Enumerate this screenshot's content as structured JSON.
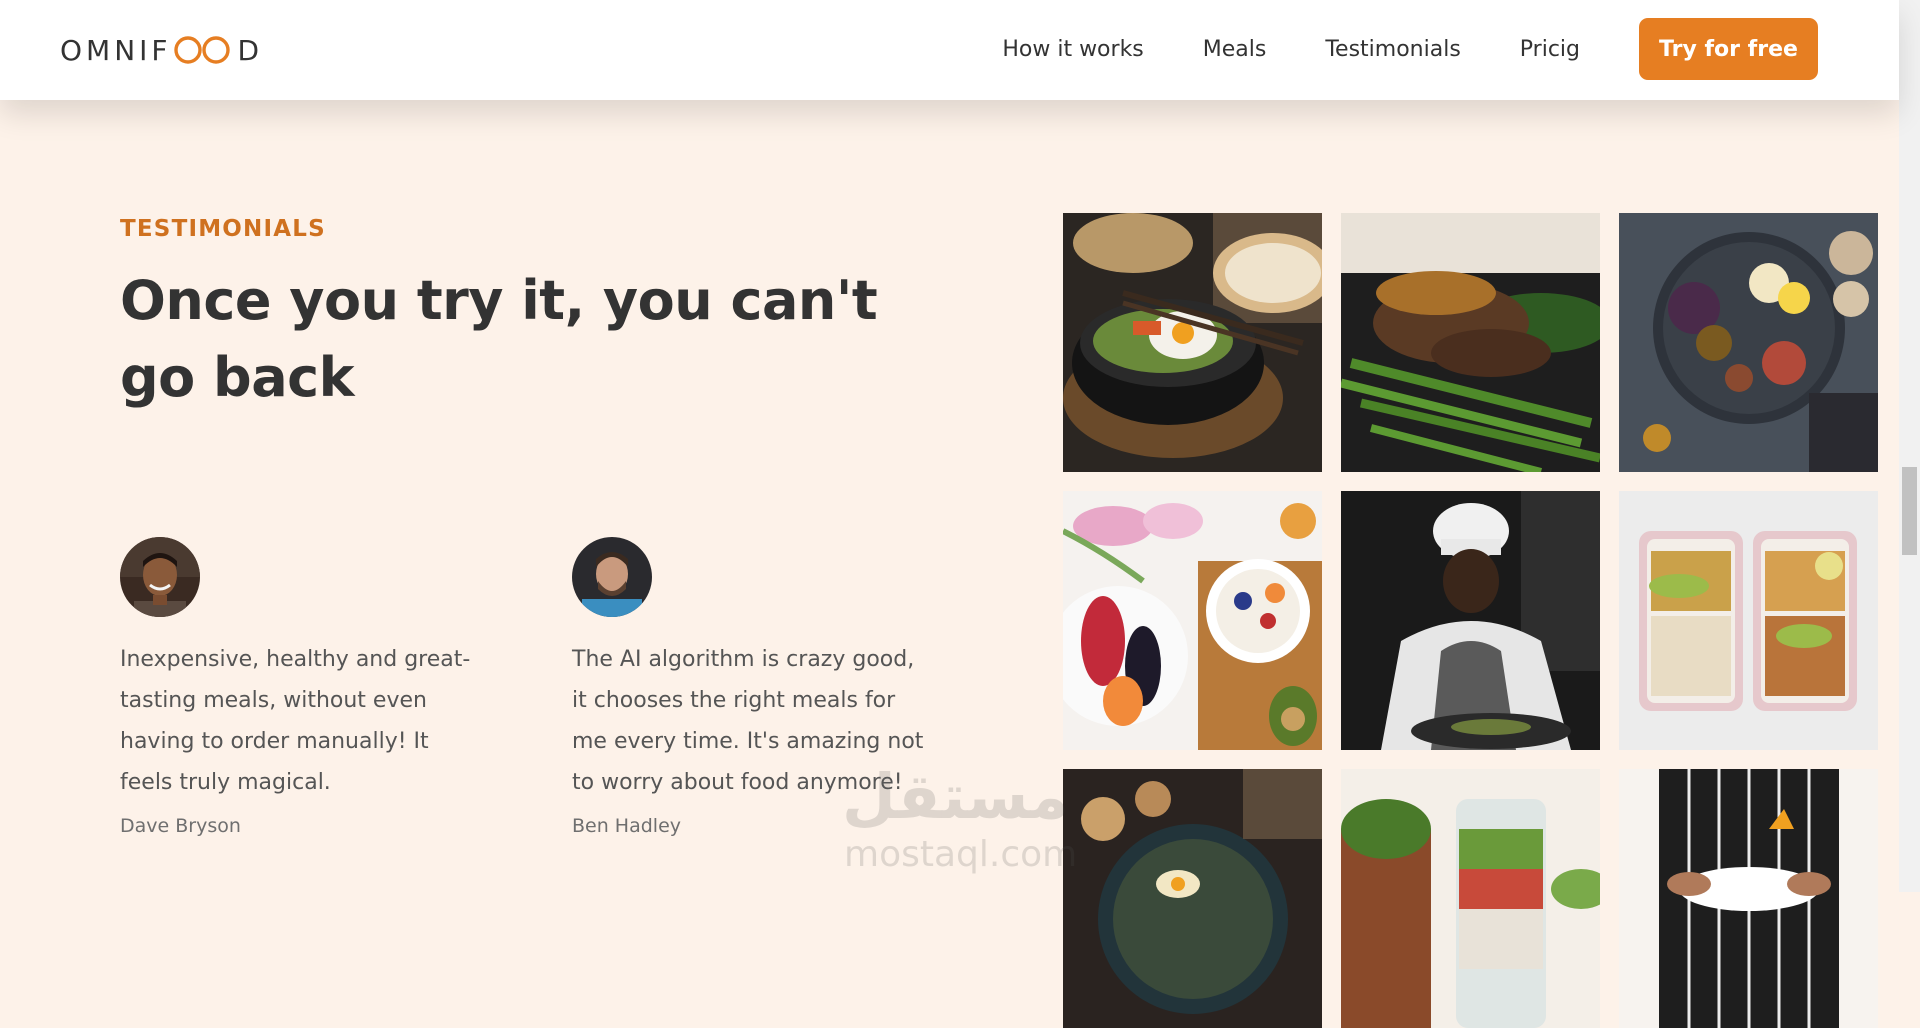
{
  "header": {
    "logo_text_left": "OMNIF",
    "logo_text_right": "D",
    "nav": [
      "How it works",
      "Meals",
      "Testimonials",
      "Pricig"
    ],
    "cta": "Try for free"
  },
  "section": {
    "subheading": "TESTIMONIALS",
    "heading": "Once you try it, you can't go back"
  },
  "testimonials": [
    {
      "quote": "Inexpensive, healthy and great-tasting meals, without even having to order manually! It feels truly magical.",
      "author": "Dave Bryson"
    },
    {
      "quote": "The AI algorithm is crazy good, it chooses the right meals for me every time. It's amazing not to worry about food anymore!",
      "author": "Ben Hadley"
    }
  ],
  "watermark": {
    "arabic": "مستقل",
    "latin": "mostaql.com"
  },
  "colors": {
    "accent": "#e67e22",
    "accent_dark": "#cf711f",
    "background": "#fdf2e9",
    "text": "#333333"
  },
  "icons": [
    "logo-infinity-icon"
  ]
}
